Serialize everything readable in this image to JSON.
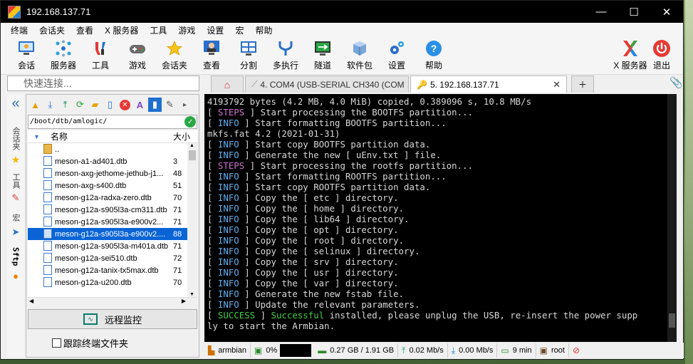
{
  "window": {
    "title": "192.168.137.71"
  },
  "titlebar": {
    "minimize": "—",
    "maximize": "☐",
    "close": "✕"
  },
  "menu": [
    "终端",
    "会话夹",
    "查看",
    "X 服务器",
    "工具",
    "游戏",
    "设置",
    "宏",
    "帮助"
  ],
  "toolbar": {
    "items": [
      {
        "label": "会话",
        "icon": "monitor-icon"
      },
      {
        "label": "服务器",
        "icon": "network-icon"
      },
      {
        "label": "工具",
        "icon": "tools-icon"
      },
      {
        "label": "游戏",
        "icon": "gamepad-icon"
      },
      {
        "label": "会话夹",
        "icon": "star-icon"
      },
      {
        "label": "查看",
        "icon": "user-icon"
      },
      {
        "label": "分割",
        "icon": "split-icon"
      },
      {
        "label": "多执行",
        "icon": "fork-icon"
      },
      {
        "label": "隧道",
        "icon": "tunnel-icon"
      },
      {
        "label": "软件包",
        "icon": "package-icon"
      },
      {
        "label": "设置",
        "icon": "gear-icon"
      },
      {
        "label": "帮助",
        "icon": "help-icon"
      }
    ],
    "xserver": "X 服务器",
    "exit": "退出"
  },
  "quick_connect": {
    "placeholder": "快速连接..."
  },
  "tabs": [
    {
      "label": "4. COM4  (USB-SERIAL CH340 (COM",
      "active": false
    },
    {
      "label": "5. 192.168.137.71",
      "active": true
    }
  ],
  "side_strip": [
    "会话夹",
    "工具",
    "宏",
    "Sftp"
  ],
  "sftp": {
    "path": "/boot/dtb/amlogic/",
    "col_name": "名称",
    "col_size": "大小",
    "files": [
      {
        "name": "..",
        "size": "",
        "folder": true
      },
      {
        "name": "meson-a1-ad401.dtb",
        "size": "3"
      },
      {
        "name": "meson-axg-jethome-jethub-j1...",
        "size": "48"
      },
      {
        "name": "meson-axg-s400.dtb",
        "size": "51"
      },
      {
        "name": "meson-g12a-radxa-zero.dtb",
        "size": "70"
      },
      {
        "name": "meson-g12a-s905l3a-cm311.dtb",
        "size": "71"
      },
      {
        "name": "meson-g12a-s905l3a-e900v2...",
        "size": "71"
      },
      {
        "name": "meson-g12a-s905l3a-e900v2....",
        "size": "88",
        "selected": true
      },
      {
        "name": "meson-g12a-s905l3a-m401a.dtb",
        "size": "71"
      },
      {
        "name": "meson-g12a-sei510.dtb",
        "size": "72"
      },
      {
        "name": "meson-g12a-tanix-tx5max.dtb",
        "size": "71"
      },
      {
        "name": "meson-g12a-u200.dtb",
        "size": "70"
      }
    ],
    "monitor_label": "远程监控",
    "track_label": "跟踪终端文件夹"
  },
  "terminal": {
    "lines": [
      [
        [
          "",
          "4193792 bytes (4.2 MB, 4.0 MiB) copied, 0.389096 s, 10.8 MB/s"
        ]
      ],
      [
        [
          "",
          "[ "
        ],
        [
          "steps",
          "STEPS"
        ],
        [
          "",
          " ] Start processing the BOOTFS partition..."
        ]
      ],
      [
        [
          "",
          "[ "
        ],
        [
          "info",
          "INFO"
        ],
        [
          "",
          " ] Start formatting BOOTFS partition..."
        ]
      ],
      [
        [
          "",
          "mkfs.fat 4.2 (2021-01-31)"
        ]
      ],
      [
        [
          "",
          "[ "
        ],
        [
          "info",
          "INFO"
        ],
        [
          "",
          " ] Start copy BOOTFS partition data."
        ]
      ],
      [
        [
          "",
          "[ "
        ],
        [
          "info",
          "INFO"
        ],
        [
          "",
          " ] Generate the new [ uEnv.txt ] file."
        ]
      ],
      [
        [
          "",
          "[ "
        ],
        [
          "steps",
          "STEPS"
        ],
        [
          "",
          " ] Start processing the rootfs partition..."
        ]
      ],
      [
        [
          "",
          "[ "
        ],
        [
          "info",
          "INFO"
        ],
        [
          "",
          " ] Start formatting ROOTFS partition..."
        ]
      ],
      [
        [
          "",
          "[ "
        ],
        [
          "info",
          "INFO"
        ],
        [
          "",
          " ] Start copy ROOTFS partition data."
        ]
      ],
      [
        [
          "",
          "[ "
        ],
        [
          "info",
          "INFO"
        ],
        [
          "",
          " ] Copy the [ etc ] directory."
        ]
      ],
      [
        [
          "",
          "[ "
        ],
        [
          "info",
          "INFO"
        ],
        [
          "",
          " ] Copy the [ home ] directory."
        ]
      ],
      [
        [
          "",
          "[ "
        ],
        [
          "info",
          "INFO"
        ],
        [
          "",
          " ] Copy the [ lib64 ] directory."
        ]
      ],
      [
        [
          "",
          "[ "
        ],
        [
          "info",
          "INFO"
        ],
        [
          "",
          " ] Copy the [ opt ] directory."
        ]
      ],
      [
        [
          "",
          "[ "
        ],
        [
          "info",
          "INFO"
        ],
        [
          "",
          " ] Copy the [ root ] directory."
        ]
      ],
      [
        [
          "",
          "[ "
        ],
        [
          "info",
          "INFO"
        ],
        [
          "",
          " ] Copy the [ selinux ] directory."
        ]
      ],
      [
        [
          "",
          "[ "
        ],
        [
          "info",
          "INFO"
        ],
        [
          "",
          " ] Copy the [ srv ] directory."
        ]
      ],
      [
        [
          "",
          "[ "
        ],
        [
          "info",
          "INFO"
        ],
        [
          "",
          " ] Copy the [ usr ] directory."
        ]
      ],
      [
        [
          "",
          "[ "
        ],
        [
          "info",
          "INFO"
        ],
        [
          "",
          " ] Copy the [ var ] directory."
        ]
      ],
      [
        [
          "",
          "[ "
        ],
        [
          "info",
          "INFO"
        ],
        [
          "",
          " ] Generate the new fstab file."
        ]
      ],
      [
        [
          "",
          "[ "
        ],
        [
          "info",
          "INFO"
        ],
        [
          "",
          " ] Update the relevant parameters."
        ]
      ],
      [
        [
          "",
          "[ "
        ],
        [
          "success",
          "SUCCESS"
        ],
        [
          "",
          " ] "
        ],
        [
          "success",
          "Successful"
        ],
        [
          "",
          " installed, please unplug the USB, re-insert the power supp"
        ]
      ],
      [
        [
          "",
          "ly to start the Armbian."
        ]
      ]
    ]
  },
  "status": {
    "host": "armbian",
    "cpu": "0%",
    "memory": "0.27 GB / 1.91 GB",
    "upload": "0.02 Mb/s",
    "download": "0.00 Mb/s",
    "uptime": "9 min",
    "user": "root"
  },
  "colors": {
    "info": "#5ab0f0",
    "steps": "#d070d0",
    "success": "#40d040",
    "selection": "#0a64d6"
  }
}
